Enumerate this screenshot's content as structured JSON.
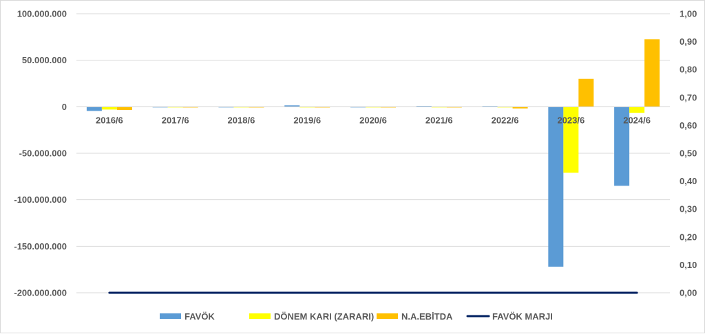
{
  "chart_data": {
    "type": "bar",
    "categories": [
      "2016/6",
      "2017/6",
      "2018/6",
      "2019/6",
      "2020/6",
      "2021/6",
      "2022/6",
      "2023/6",
      "2024/6"
    ],
    "series": [
      {
        "name": "FAVÖK",
        "type": "bar",
        "axis": "left",
        "color": "#5b9bd5",
        "values": [
          -4500000,
          -300000,
          -300000,
          1500000,
          -300000,
          800000,
          700000,
          -172000000,
          -85000000
        ]
      },
      {
        "name": "DÖNEM KARI (ZARARI)",
        "type": "bar",
        "axis": "left",
        "color": "#ffff00",
        "values": [
          -3000000,
          -300000,
          -300000,
          -500000,
          -300000,
          -400000,
          -600000,
          -71000000,
          -6500000
        ]
      },
      {
        "name": "N.A.EBİTDA",
        "type": "bar",
        "axis": "left",
        "color": "#ffc000",
        "values": [
          -3500000,
          -800000,
          -800000,
          -800000,
          -800000,
          -800000,
          -1800000,
          30000000,
          72500000
        ]
      },
      {
        "name": "FAVÖK MARJI",
        "type": "line",
        "axis": "right",
        "color": "#002060",
        "values": [
          0,
          0,
          0,
          0,
          0,
          0,
          0,
          0,
          0
        ]
      }
    ],
    "y_left": {
      "ylim": [
        -200000000,
        100000000
      ],
      "ticks": [
        100000000,
        50000000,
        0,
        -50000000,
        -100000000,
        -150000000,
        -200000000
      ],
      "tick_labels": [
        "100.000.000",
        "50.000.000",
        "0",
        "-50.000.000",
        "-100.000.000",
        "-150.000.000",
        "-200.000.000"
      ]
    },
    "y_right": {
      "ylim": [
        0,
        1
      ],
      "ticks": [
        1,
        0.9,
        0.8,
        0.7,
        0.6,
        0.5,
        0.4,
        0.3,
        0.2,
        0.1,
        0
      ],
      "tick_labels": [
        "1,00",
        "0,90",
        "0,80",
        "0,70",
        "0,60",
        "0,50",
        "0,40",
        "0,30",
        "0,20",
        "0,10",
        "0,00"
      ]
    },
    "grid": true,
    "legend_position": "bottom"
  }
}
